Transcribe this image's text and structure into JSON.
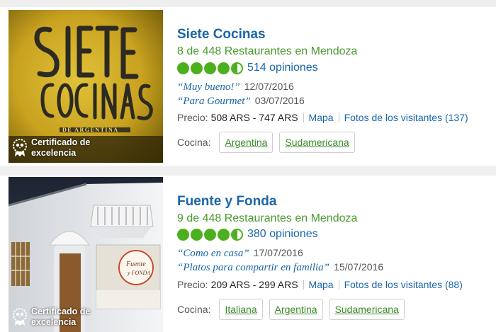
{
  "colors": {
    "link_blue": "#1a66a8",
    "green": "#4a9a2e",
    "bubble_green": "#4caf1e"
  },
  "restaurants": [
    {
      "image_sign_text": "SIETE COCINAS DE ARGENTINA",
      "badge": "Certificado de excelencia",
      "badge_line1": "Certificado de",
      "badge_line2": "excelencia",
      "name": "Siete Cocinas",
      "rank": "8 de 448 Restaurantes en Mendoza",
      "rating": 4.5,
      "reviews": "514 opiniones",
      "quotes": [
        {
          "text": "“Muy bueno!”",
          "date": "12/07/2016"
        },
        {
          "text": "“Para Gourmet”",
          "date": "03/07/2016"
        }
      ],
      "price_label": "Precio:",
      "price": "508 ARS - 747 ARS",
      "map_link": "Mapa",
      "photos_link": "Fotos de los visitantes (137)",
      "cuisine_label": "Cocina:",
      "cuisines": [
        "Argentina",
        "Sudamericana"
      ]
    },
    {
      "image_sign_text": "Fuente y Fonda",
      "badge": "Certificado de excelencia",
      "badge_line1": "Certificado de",
      "badge_line2": "excelencia",
      "name": "Fuente y Fonda",
      "rank": "9 de 448 Restaurantes en Mendoza",
      "rating": 4.5,
      "reviews": "380 opiniones",
      "quotes": [
        {
          "text": "“Como en casa”",
          "date": "17/07/2016"
        },
        {
          "text": "“Platos para compartir en familia”",
          "date": "15/07/2016"
        }
      ],
      "price_label": "Precio:",
      "price": "209 ARS - 299 ARS",
      "map_link": "Mapa",
      "photos_link": "Fotos de los visitantes (88)",
      "cuisine_label": "Cocina:",
      "cuisines": [
        "Italiana",
        "Argentina",
        "Sudamericana"
      ]
    }
  ]
}
